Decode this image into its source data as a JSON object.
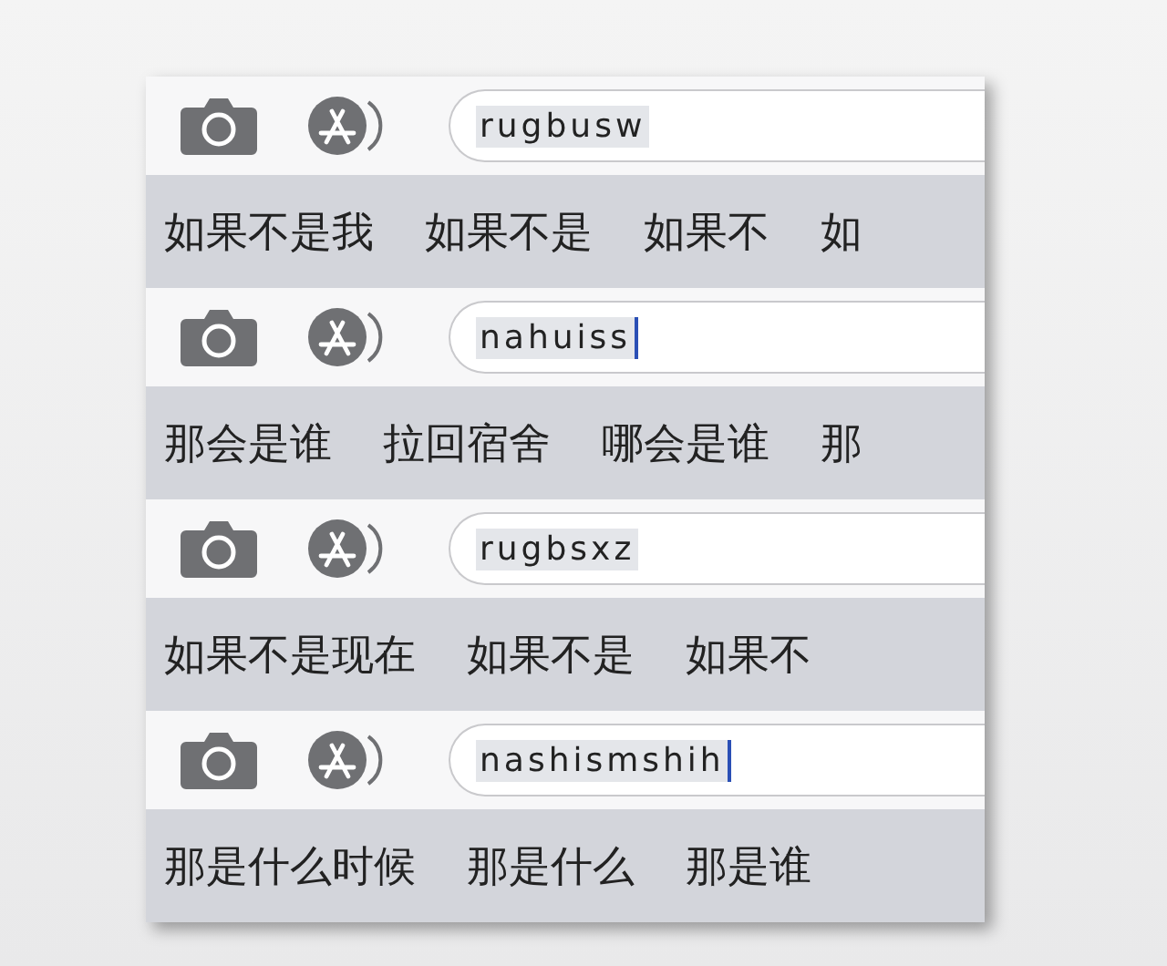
{
  "bars": [
    {
      "input": {
        "value": "rugbusw",
        "cursor": false
      },
      "candidates": [
        "如果不是我",
        "如果不是",
        "如果不",
        "如"
      ]
    },
    {
      "input": {
        "value": "nahuiss",
        "cursor": true
      },
      "candidates": [
        "那会是谁",
        "拉回宿舍",
        "哪会是谁",
        "那"
      ]
    },
    {
      "input": {
        "value": "rugbsxz",
        "cursor": false
      },
      "candidates": [
        "如果不是现在",
        "如果不是",
        "如果不"
      ]
    },
    {
      "input": {
        "value": "nashismshih",
        "cursor": true
      },
      "candidates": [
        "那是什么时候",
        "那是什么",
        "那是谁"
      ]
    }
  ]
}
